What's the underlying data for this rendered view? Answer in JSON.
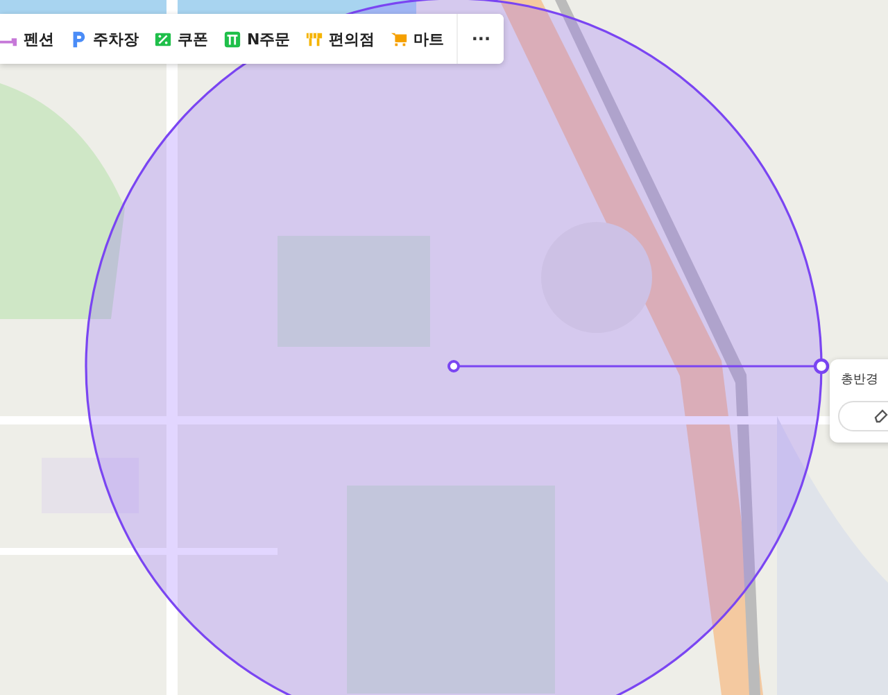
{
  "categories": [
    {
      "label": "펜션",
      "kind": "pension"
    },
    {
      "label": "주차장",
      "kind": "parking"
    },
    {
      "label": "쿠폰",
      "kind": "coupon"
    },
    {
      "label": "N주문",
      "kind": "order"
    },
    {
      "label": "편의점",
      "kind": "store"
    },
    {
      "label": "마트",
      "kind": "mart"
    }
  ],
  "more": "···",
  "radius_panel": {
    "title": "총반경"
  }
}
